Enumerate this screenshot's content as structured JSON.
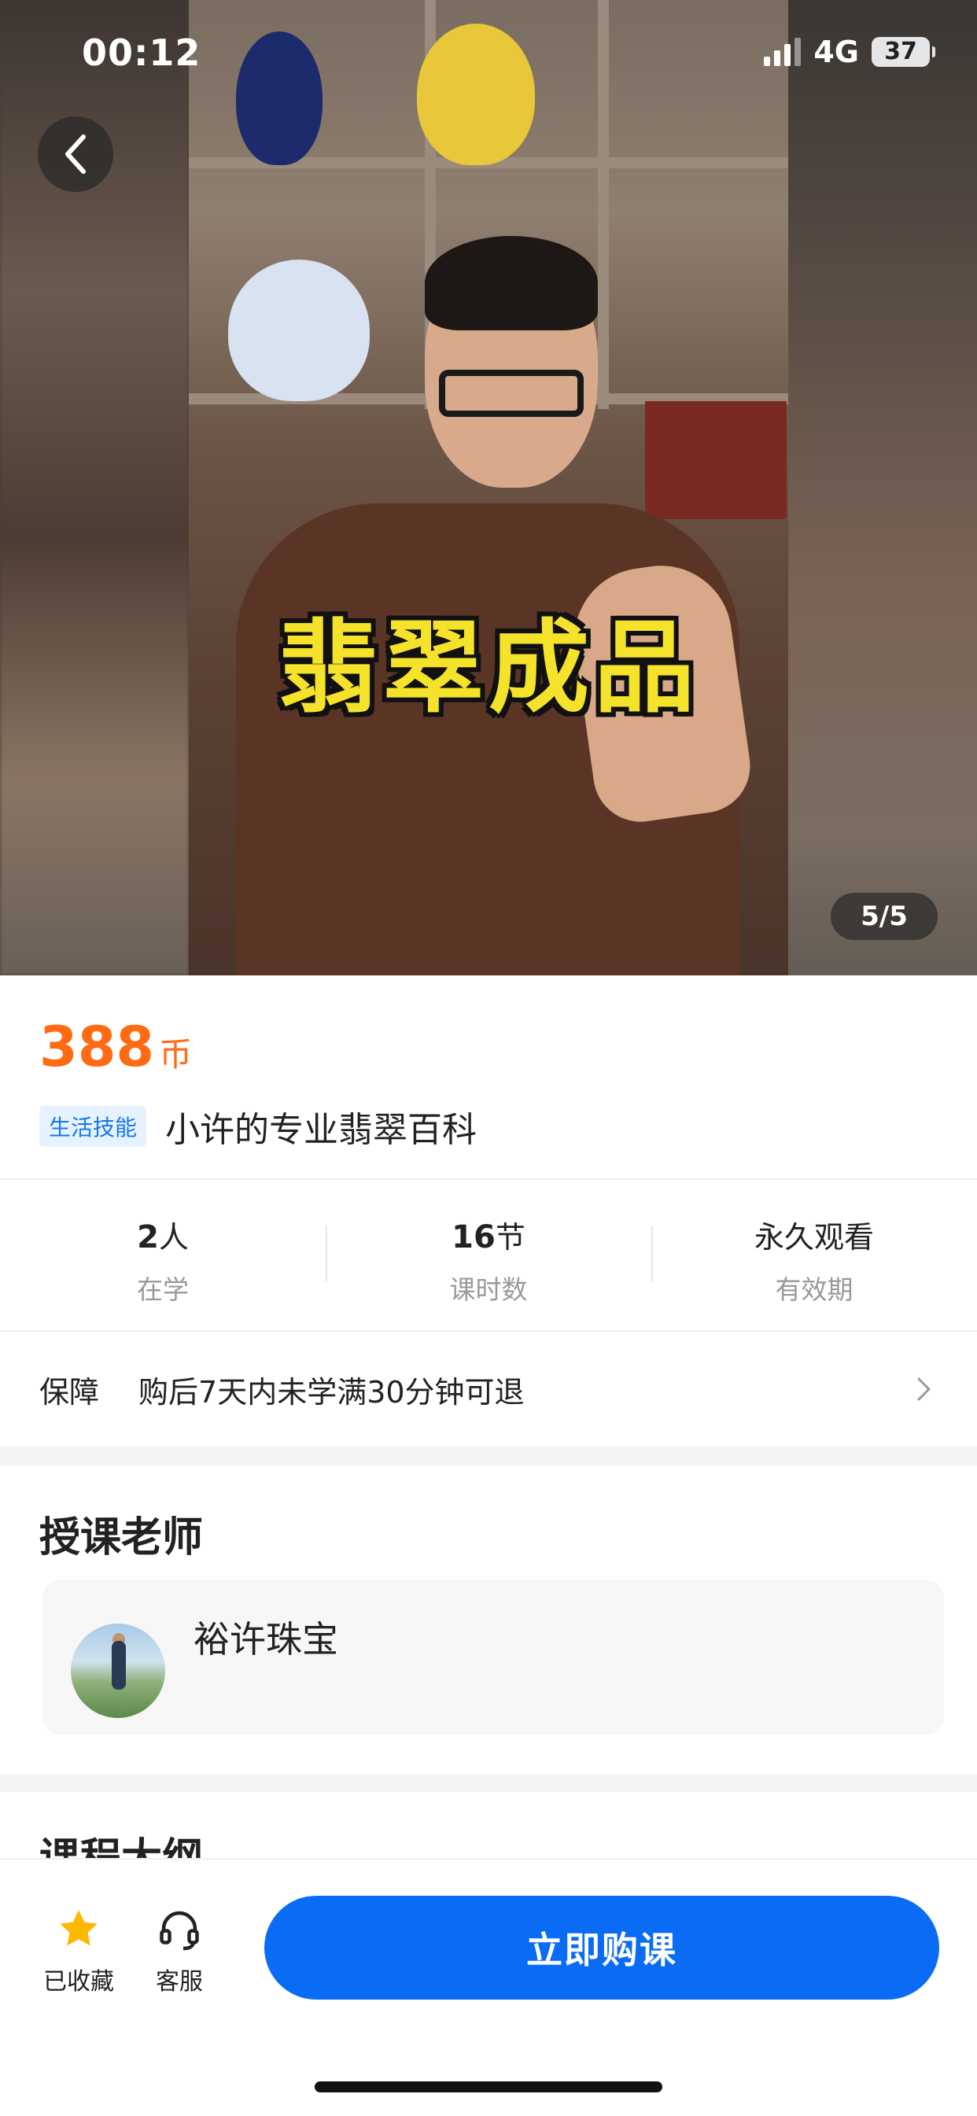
{
  "status_bar": {
    "time": "00:12",
    "network": "4G",
    "battery": "37"
  },
  "hero": {
    "caption": "翡翠成品",
    "counter": "5/5"
  },
  "price": {
    "amount": "388",
    "unit": "币"
  },
  "course": {
    "tag": "生活技能",
    "title": "小许的专业翡翠百科"
  },
  "stats": [
    {
      "value": "2",
      "unit": "人",
      "label": "在学"
    },
    {
      "value": "16",
      "unit": "节",
      "label": "课时数"
    },
    {
      "value": "永久观看",
      "unit": "",
      "label": "有效期"
    }
  ],
  "guarantee": {
    "label": "保障",
    "text": "购后7天内未学满30分钟可退"
  },
  "teacher_section": {
    "title": "授课老师",
    "name": "裕许珠宝"
  },
  "outline_section": {
    "title": "课程大纲"
  },
  "bottom_bar": {
    "favorite_label": "已收藏",
    "service_label": "客服",
    "buy_label": "立即购课"
  },
  "colors": {
    "price": "#ff6a13",
    "primary": "#0a6cf5",
    "star": "#ffb800",
    "tag_bg": "#e6f2ff",
    "tag_text": "#1677e6"
  }
}
